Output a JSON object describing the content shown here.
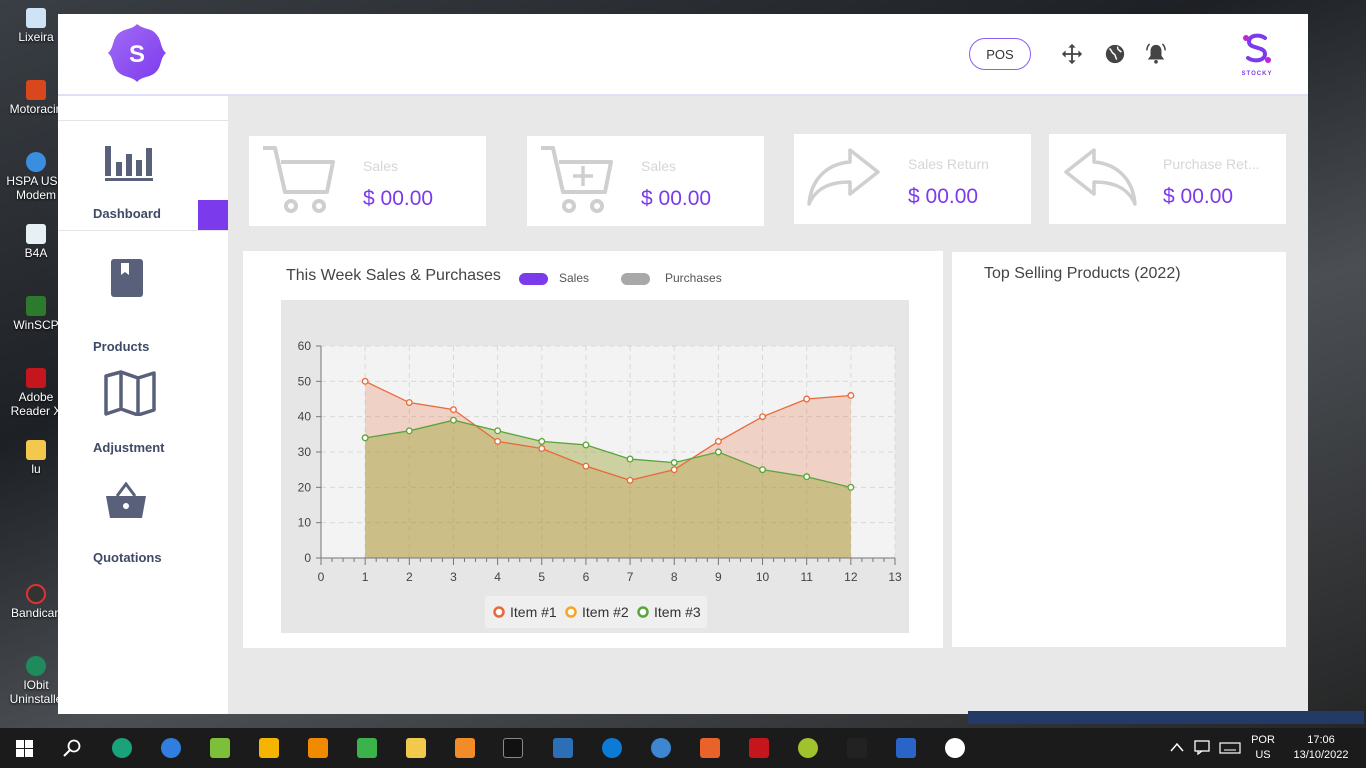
{
  "desktop": {
    "icons": [
      {
        "label": "Lixeira"
      },
      {
        "label": "Motoracin"
      },
      {
        "label": "HSPA USB Modem"
      },
      {
        "label": "B4A"
      },
      {
        "label": "WinSCP"
      },
      {
        "label": "Adobe Reader X"
      },
      {
        "label": "lu"
      },
      {
        "label": "Bandican"
      },
      {
        "label": "IObit Uninstalle"
      }
    ]
  },
  "header": {
    "logo_letter": "S",
    "pos_label": "POS",
    "brand": "STOCKY",
    "accent": "#7c3aed"
  },
  "sidebar": {
    "items": [
      {
        "label": "Dashboard",
        "icon": "bar-chart-icon",
        "active": true
      },
      {
        "label": "Products",
        "icon": "book-icon"
      },
      {
        "label": "Adjustment",
        "icon": "map-icon"
      },
      {
        "label": "Quotations",
        "icon": "basket-icon"
      }
    ]
  },
  "stats": [
    {
      "caption": "Sales",
      "value": "$ 00.00",
      "icon": "cart-icon"
    },
    {
      "caption": "Sales",
      "value": "$ 00.00",
      "icon": "cart-plus-icon"
    },
    {
      "caption": "Sales Return",
      "value": "$ 00.00",
      "icon": "share-arrow-icon"
    },
    {
      "caption": "Purchase Ret...",
      "value": "$ 00.00",
      "icon": "reply-arrow-icon"
    }
  ],
  "weekly": {
    "title": "This Week Sales & Purchases",
    "legend_sales": "Sales",
    "legend_purchases": "Purchases",
    "sales_color": "#7c3aed",
    "purchases_color": "#a8a8a8"
  },
  "top_selling": {
    "title": "Top Selling Products (2022)"
  },
  "chart_data": {
    "type": "area",
    "x": [
      1,
      2,
      3,
      4,
      5,
      6,
      7,
      8,
      9,
      10,
      11,
      12
    ],
    "series": [
      {
        "name": "Item #1",
        "color": "#e86a3a",
        "values": [
          50,
          44,
          42,
          33,
          31,
          26,
          22,
          25,
          33,
          40,
          45,
          46
        ]
      },
      {
        "name": "Item #2",
        "color": "#f5a623",
        "values": [
          34,
          36,
          39,
          36,
          33,
          32,
          28,
          27,
          30,
          25,
          23,
          20
        ]
      },
      {
        "name": "Item #3",
        "color": "#5aa53b",
        "values": [
          34,
          36,
          39,
          36,
          33,
          32,
          28,
          27,
          30,
          25,
          23,
          20
        ]
      }
    ],
    "xlim": [
      0,
      13
    ],
    "ylim": [
      0,
      60
    ],
    "xticks": [
      0,
      1,
      2,
      3,
      4,
      5,
      6,
      7,
      8,
      9,
      10,
      11,
      12,
      13
    ],
    "yticks": [
      0,
      10,
      20,
      30,
      40,
      50,
      60
    ],
    "grid": true,
    "legend": "bottom"
  },
  "tray": {
    "lang": "POR",
    "layout": "US",
    "time": "17:06",
    "date": "13/10/2022"
  }
}
